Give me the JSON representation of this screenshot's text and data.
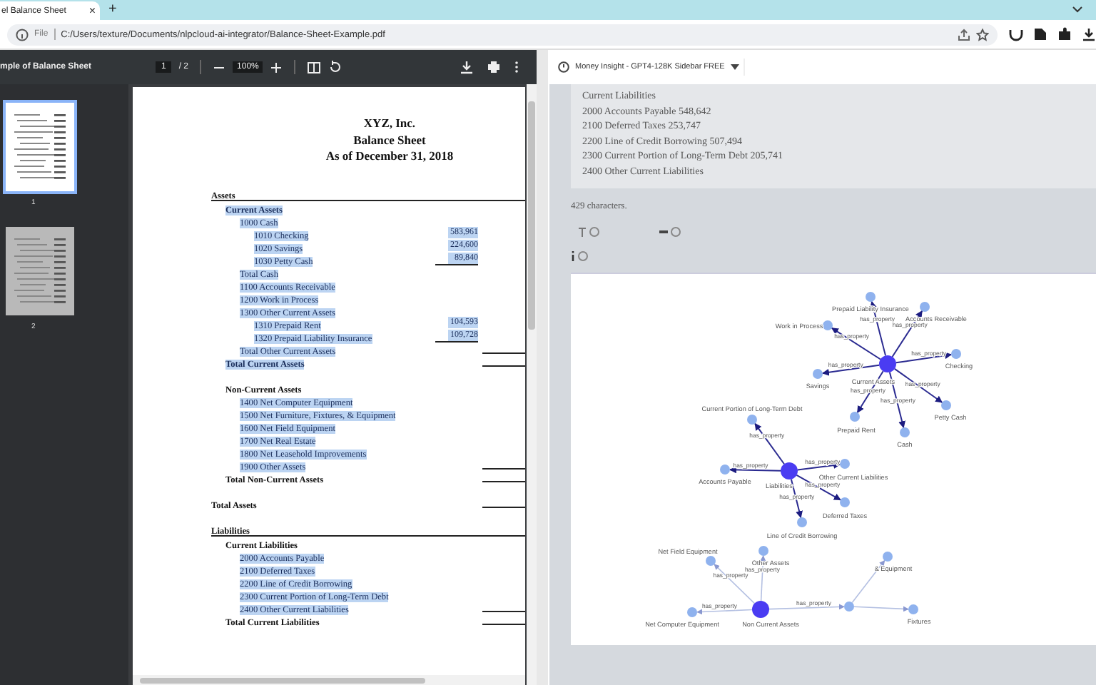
{
  "browser": {
    "tab": {
      "title": "el Balance Sheet",
      "close": "×"
    },
    "new_tab": "+",
    "address": {
      "scheme": "File",
      "url": "C:/Users/texture/Documents/nlpcloud-ai-integrator/Balance-Sheet-Example.pdf"
    }
  },
  "pdf_viewer": {
    "title": "mple of Balance Sheet",
    "page": "1",
    "page_total": "/ 2",
    "zoom": "100%",
    "thumbnails": [
      {
        "number": "1",
        "selected": true
      },
      {
        "number": "2",
        "selected": false
      }
    ],
    "document": {
      "company": "XYZ, Inc.",
      "title": "Balance Sheet",
      "date": "As of December 31, 2018",
      "rows": [
        {
          "label": "Assets",
          "bold": true,
          "highlighted": false,
          "ruled": true,
          "children": [
            {
              "label": "Current Assets",
              "bold": true,
              "highlighted": true,
              "children": [
                {
                  "label": "1000 Cash",
                  "highlighted": true,
                  "children": [
                    {
                      "label": "1010 Checking",
                      "amount": "583,961",
                      "highlighted": true
                    },
                    {
                      "label": "1020 Savings",
                      "amount": "224,600",
                      "highlighted": true
                    },
                    {
                      "label": "1030 Petty Cash",
                      "amount": "89,840",
                      "highlighted": true,
                      "amount_rule": true
                    }
                  ]
                },
                {
                  "label": "Total Cash",
                  "highlighted": true
                },
                {
                  "label": "1100 Accounts Receivable",
                  "highlighted": true
                },
                {
                  "label": "1200 Work in Process",
                  "highlighted": true
                },
                {
                  "label": "1300 Other Current Assets",
                  "highlighted": true,
                  "children": [
                    {
                      "label": "1310 Prepaid Rent",
                      "amount": "104,593",
                      "highlighted": true
                    },
                    {
                      "label": "1320 Prepaid Liability Insurance",
                      "amount": "109,728",
                      "highlighted": true,
                      "amount_rule": true
                    }
                  ]
                },
                {
                  "label": "Total Other Current Assets",
                  "highlighted": true,
                  "total_rule": true
                }
              ]
            },
            {
              "label": "Total Current Assets",
              "bold": true,
              "highlighted": true,
              "total_rule": true
            },
            {
              "label": "Non-Current Assets",
              "bold": true,
              "highlighted": false,
              "children": [
                {
                  "label": "1400 Net Computer Equipment",
                  "highlighted": true
                },
                {
                  "label": "1500 Net Furniture, Fixtures, & Equipment",
                  "highlighted": true
                },
                {
                  "label": "1600 Net Field Equipment",
                  "highlighted": true
                },
                {
                  "label": "1700 Net Real Estate",
                  "highlighted": true
                },
                {
                  "label": "1800 Net Leasehold Improvements",
                  "highlighted": true
                },
                {
                  "label": "1900 Other Assets",
                  "highlighted": true,
                  "total_rule": true
                }
              ]
            },
            {
              "label": "Total Non-Current Assets",
              "bold": true,
              "highlighted": false,
              "total_rule": true
            }
          ]
        },
        {
          "label": "Total Assets",
          "bold": true,
          "highlighted": false,
          "total_rule": true
        },
        {
          "label": "Liabilities",
          "bold": true,
          "highlighted": false,
          "ruled": true,
          "children": [
            {
              "label": "Current Liabilities",
              "bold": true,
              "highlighted": false,
              "children": [
                {
                  "label": "2000 Accounts Payable",
                  "highlighted": true
                },
                {
                  "label": "2100 Deferred Taxes",
                  "highlighted": true
                },
                {
                  "label": "2200 Line of Credit Borrowing",
                  "highlighted": true
                },
                {
                  "label": "2300 Current Portion of Long-Term Debt",
                  "highlighted": true
                },
                {
                  "label": "2400 Other Current Liabilities",
                  "highlighted": true,
                  "total_rule": true
                }
              ]
            },
            {
              "label": "Total Current Liabilities",
              "bold": true,
              "highlighted": false,
              "total_rule": true
            }
          ]
        }
      ]
    }
  },
  "sidebar": {
    "app": "Money Insight - GPT4-128K Sidebar FREE",
    "text_lines": [
      "Current Liabilities",
      "2000 Accounts Payable 548,642",
      "2100 Deferred Taxes 253,747",
      "2200 Line of Credit Borrowing 507,494",
      "2300 Current Portion of Long-Term Debt 205,741",
      "2400 Other Current Liabilities"
    ],
    "char_count": "429 characters.",
    "graph": {
      "clusters": [
        {
          "hub": "Current Assets",
          "highlighted": true,
          "leaves": [
            {
              "label": "Prepaid Liability Insurance",
              "edge_label": "has_property"
            },
            {
              "label": "Accounts Receivable",
              "edge_label": "has_property"
            },
            {
              "label": "Work in Process",
              "edge_label": "has_property"
            },
            {
              "label": "Checking",
              "edge_label": "has_property"
            },
            {
              "label": "Savings",
              "edge_label": "has_property"
            },
            {
              "label": "Prepaid Rent",
              "edge_label": "has_property"
            },
            {
              "label": "Cash",
              "edge_label": "has_property"
            },
            {
              "label": "Petty Cash",
              "edge_label": "has_property"
            }
          ]
        },
        {
          "hub": "Liabilities",
          "highlighted": true,
          "leaves": [
            {
              "label": "Current Portion of Long-Term Debt",
              "edge_label": "has_property"
            },
            {
              "label": "Accounts Payable",
              "edge_label": "has_property"
            },
            {
              "label": "Other Current Liabilities",
              "edge_label": "has_property"
            },
            {
              "label": "Deferred Taxes",
              "edge_label": "has_property"
            },
            {
              "label": "Line of Credit Borrowing",
              "edge_label": "has_property"
            }
          ]
        },
        {
          "hub": "Non Current Assets",
          "highlighted": false,
          "leaves": [
            {
              "label": "Other Assets",
              "edge_label": "has_property"
            },
            {
              "label": "Net Field Equipment",
              "edge_label": "has_property"
            },
            {
              "label": "Net Computer Equipment",
              "edge_label": "has_property"
            },
            {
              "edge_label": "has_property",
              "children": [
                {
                  "label": "& Equipment"
                },
                {
                  "label": "Fixtures"
                }
              ]
            }
          ]
        }
      ]
    }
  }
}
